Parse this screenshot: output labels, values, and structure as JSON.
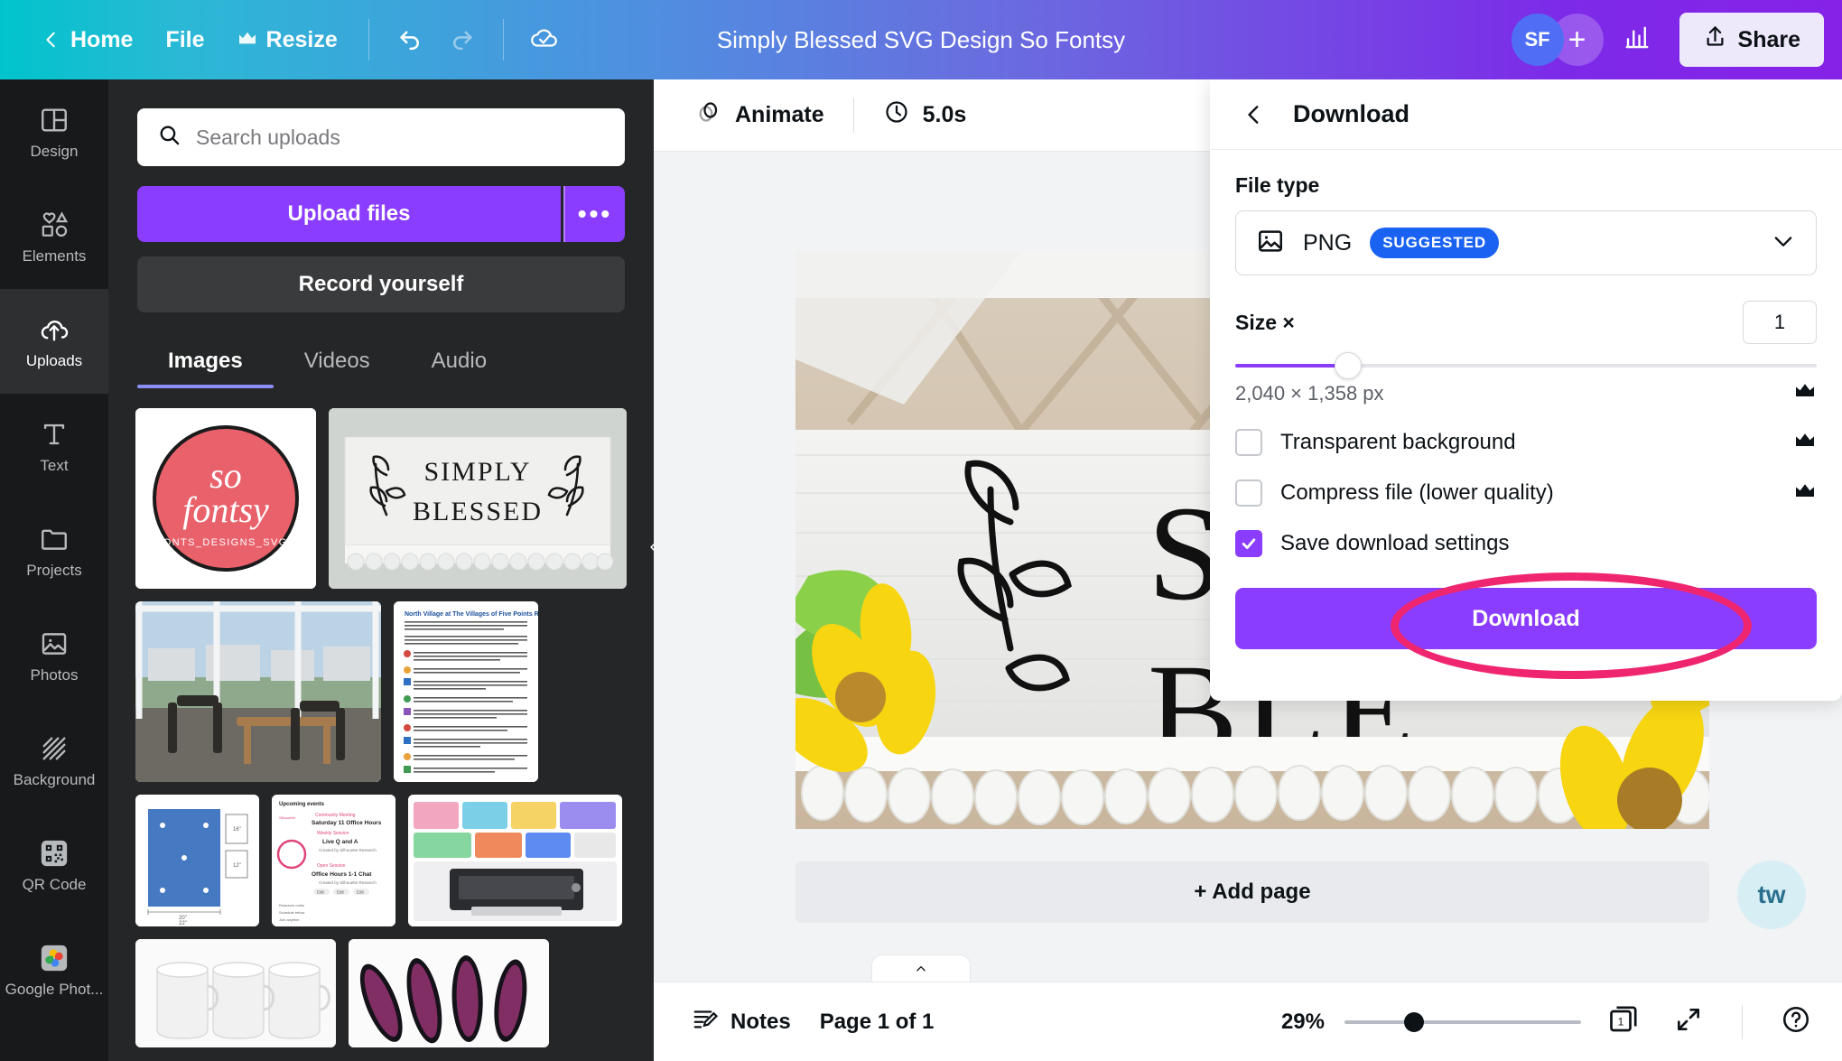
{
  "topbar": {
    "back_icon": "chevron-left-icon",
    "home_label": "Home",
    "file_label": "File",
    "resize_label": "Resize",
    "resize_crown_icon": "crown-icon",
    "undo_icon": "undo-icon",
    "redo_icon": "redo-icon",
    "cloud_saved_icon": "cloud-check-icon",
    "design_title": "Simply Blessed SVG Design So Fontsy",
    "avatar_initials": "SF",
    "add_collaborator_icon": "plus-icon",
    "insights_icon": "bar-chart-icon",
    "share_label": "Share",
    "share_icon": "upload-arrow-icon",
    "gradient_start": "#00c4cc",
    "gradient_end": "#8622e8"
  },
  "sidebar": {
    "items": [
      {
        "label": "Design",
        "icon": "layout-icon",
        "active": false
      },
      {
        "label": "Elements",
        "icon": "shapes-icon",
        "active": false
      },
      {
        "label": "Uploads",
        "icon": "cloud-upload-icon",
        "active": true
      },
      {
        "label": "Text",
        "icon": "text-t-icon",
        "active": false
      },
      {
        "label": "Projects",
        "icon": "folder-icon",
        "active": false
      },
      {
        "label": "Photos",
        "icon": "photo-icon",
        "active": false
      },
      {
        "label": "Background",
        "icon": "hatch-pattern-icon",
        "active": false
      },
      {
        "label": "QR Code",
        "icon": "qr-code-icon",
        "active": false
      },
      {
        "label": "Google Phot...",
        "icon": "google-photos-icon",
        "active": false
      }
    ]
  },
  "uploads_panel": {
    "search_placeholder": "Search uploads",
    "search_value": "",
    "search_icon": "search-icon",
    "upload_files_label": "Upload files",
    "more_options_label": "•••",
    "record_yourself_label": "Record yourself",
    "tabs": [
      {
        "label": "Images",
        "active": true
      },
      {
        "label": "Videos",
        "active": false
      },
      {
        "label": "Audio",
        "active": false
      }
    ],
    "collapse_icon": "chevron-left-icon",
    "thumbnails": [
      {
        "name": "so-fontsy-logo",
        "alt": "so fontsy FONTS DESIGNS SVGS round red logo"
      },
      {
        "name": "simply-blessed-sign",
        "alt": "SIMPLY BLESSED white wood sign"
      },
      {
        "name": "patio-balcony-photo",
        "alt": "balcony patio with table and chairs"
      },
      {
        "name": "north-village-rules-doc",
        "alt": "North Village at The Villages of Five Points Rules document"
      },
      {
        "name": "blue-floorplan",
        "alt": "blue technical floor plan drawing"
      },
      {
        "name": "upcoming-events-flyer",
        "alt": "Upcoming events Silhouette flyer"
      },
      {
        "name": "printer-product-collage",
        "alt": "colorful printer product collage"
      },
      {
        "name": "white-mugs-photo",
        "alt": "three white ceramic mugs"
      },
      {
        "name": "pink-glitter-nails",
        "alt": "pink glitter press-on nails"
      }
    ]
  },
  "canvas_toolbar": {
    "animate_label": "Animate",
    "animate_icon": "animate-circles-icon",
    "timer_label": "5.0s",
    "timer_icon": "clock-icon"
  },
  "canvas": {
    "add_page_label": "+ Add page",
    "design_text_line1": "SIM",
    "design_text_line2": "BLE",
    "watermark_label": "tw"
  },
  "download_panel": {
    "back_icon": "chevron-left-icon",
    "title": "Download",
    "file_type_label": "File type",
    "file_type_value": "PNG",
    "file_type_icon": "image-icon",
    "file_type_badge": "SUGGESTED",
    "file_type_chevron": "chevron-down-icon",
    "size_label": "Size ×",
    "size_value": "1",
    "size_px": "2,040 × 1,358 px",
    "size_crown_icon": "crown-icon",
    "slider_fill_percent": 19,
    "options": [
      {
        "label": "Transparent background",
        "checked": false,
        "pro": true
      },
      {
        "label": "Compress file (lower quality)",
        "checked": false,
        "pro": true
      },
      {
        "label": "Save download settings",
        "checked": true,
        "pro": false
      }
    ],
    "download_button_label": "Download",
    "accent_color": "#8b3dff",
    "badge_color": "#1a62f2",
    "annotation_color": "#f0256f"
  },
  "bottombar": {
    "notes_label": "Notes",
    "notes_icon": "notes-pencil-icon",
    "page_indicator": "Page 1 of 1",
    "zoom_level": "29%",
    "page_count_badge": "1",
    "grid_view_icon": "pages-icon",
    "fullscreen_icon": "expand-icon",
    "help_icon": "help-circle-icon",
    "expand_tab_icon": "chevron-up-icon"
  }
}
